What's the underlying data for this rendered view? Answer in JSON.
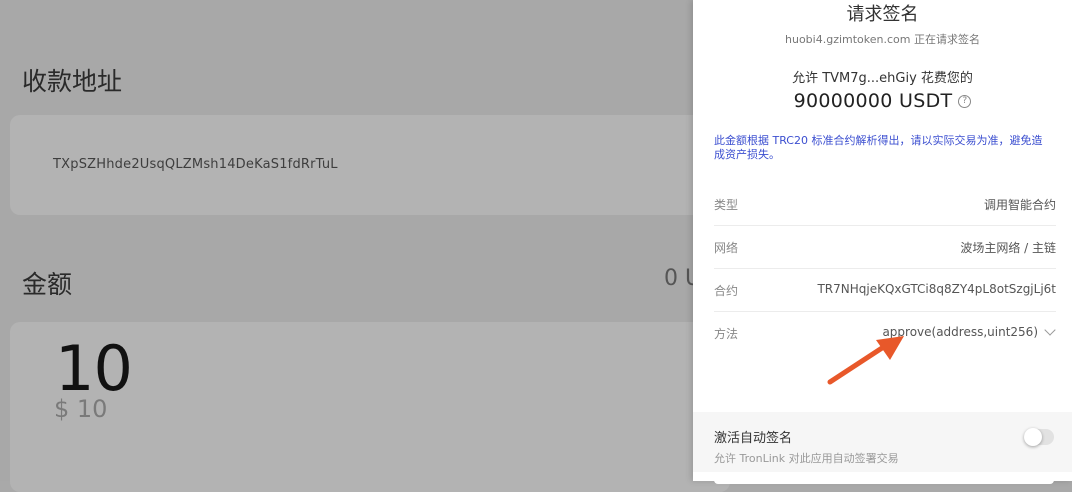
{
  "background": {
    "address_label": "收款地址",
    "address": "TXpSZHhde2UsqQLZMsh14DeKaS1fdRrTuL",
    "amount_label": "金额",
    "balance_partial": "0 U",
    "amount": "10",
    "fiat_amount": "$ 10"
  },
  "modal": {
    "title": "请求签名",
    "origin_host": "huobi4.gzimtoken.com",
    "origin_suffix": " 正在请求签名",
    "permit_text": "允许 TVM7g...ehGiy 花费您的",
    "permit_amount": "90000000 USDT",
    "help_icon": "question-circle-icon",
    "notice": "此金额根据 TRC20 标准合约解析得出，请以实际交易为准，避免造成资产损失。",
    "details": [
      {
        "key": "类型",
        "value": "调用智能合约"
      },
      {
        "key": "网络",
        "value": "波场主网络 / 主链"
      },
      {
        "key": "合约",
        "value": "TR7NHqjeKQxGTCi8q8ZY4pL8otSzgjLj6t"
      },
      {
        "key": "方法",
        "value": "approve(address,uint256)"
      }
    ],
    "auto_sign": {
      "title": "激活自动签名",
      "description": "允许 TronLink 对此应用自动签署交易",
      "enabled": false
    }
  },
  "colors": {
    "notice_blue": "#3c4fd0",
    "arrow_orange": "#e8582a",
    "overlay_gray": "#a8a8a8"
  }
}
